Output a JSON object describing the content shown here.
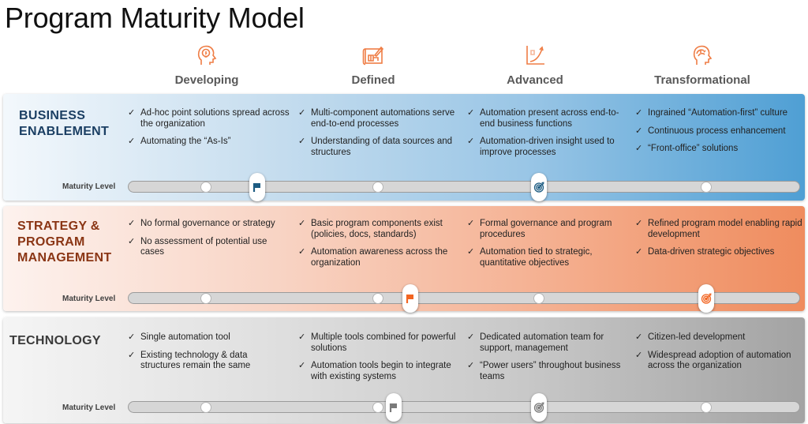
{
  "title": "Program Maturity Model",
  "colors": {
    "icon_accent": "#ef7d45",
    "business_title": "#1b3f63",
    "business_marker": "#1d5c82",
    "strategy_title": "#8a3514",
    "strategy_marker": "#f26522",
    "technology_title": "#3a3a3a",
    "technology_marker": "#7a7a7a"
  },
  "stages": [
    {
      "label": "Developing",
      "icon": "head-lightbulb-icon"
    },
    {
      "label": "Defined",
      "icon": "blueprint-icon"
    },
    {
      "label": "Advanced",
      "icon": "growth-chart-icon"
    },
    {
      "label": "Transformational",
      "icon": "head-brain-icon"
    }
  ],
  "maturity_label": "Maturity Level",
  "check_glyph": "✓",
  "categories": [
    {
      "title_lines": [
        "BUSINESS",
        "ENABLEMENT"
      ],
      "columns": [
        [
          "Ad-hoc point solutions spread across the organization",
          "Automating the “As-Is”"
        ],
        [
          "Multi-component automations serve end-to-end processes",
          "Understanding of data sources and structures"
        ],
        [
          "Automation present across end-to-end business functions",
          "Automation-driven insight used to improve processes"
        ],
        [
          "Ingrained “Automation-first” culture",
          "Continuous process enhancement",
          "“Front-office” solutions"
        ]
      ],
      "current_level": 1.3,
      "target_level": 3.0
    },
    {
      "title_lines": [
        "STRATEGY &",
        "PROGRAM",
        "MANAGEMENT"
      ],
      "columns": [
        [
          "No formal governance or strategy",
          "No assessment of potential use cases"
        ],
        [
          "Basic program components exist (policies, docs, standards)",
          "Automation awareness across the organization"
        ],
        [
          "Formal governance and program procedures",
          "Automation tied to strategic, quantitative objectives"
        ],
        [
          "Refined program model enabling rapid development",
          "Data-driven strategic objectives"
        ]
      ],
      "current_level": 2.2,
      "target_level": 4.0
    },
    {
      "title_lines": [
        "TECHNOLOGY"
      ],
      "columns": [
        [
          "Single automation tool",
          "Existing technology & data structures remain the same"
        ],
        [
          "Multiple tools combined for powerful solutions",
          "Automation tools begin to integrate with existing systems"
        ],
        [
          "Dedicated automation team for support, management",
          "“Power users” throughout business teams"
        ],
        [
          "Citizen-led development",
          "Widespread adoption of automation across the organization"
        ]
      ],
      "current_level": 2.1,
      "target_level": 3.0
    }
  ]
}
